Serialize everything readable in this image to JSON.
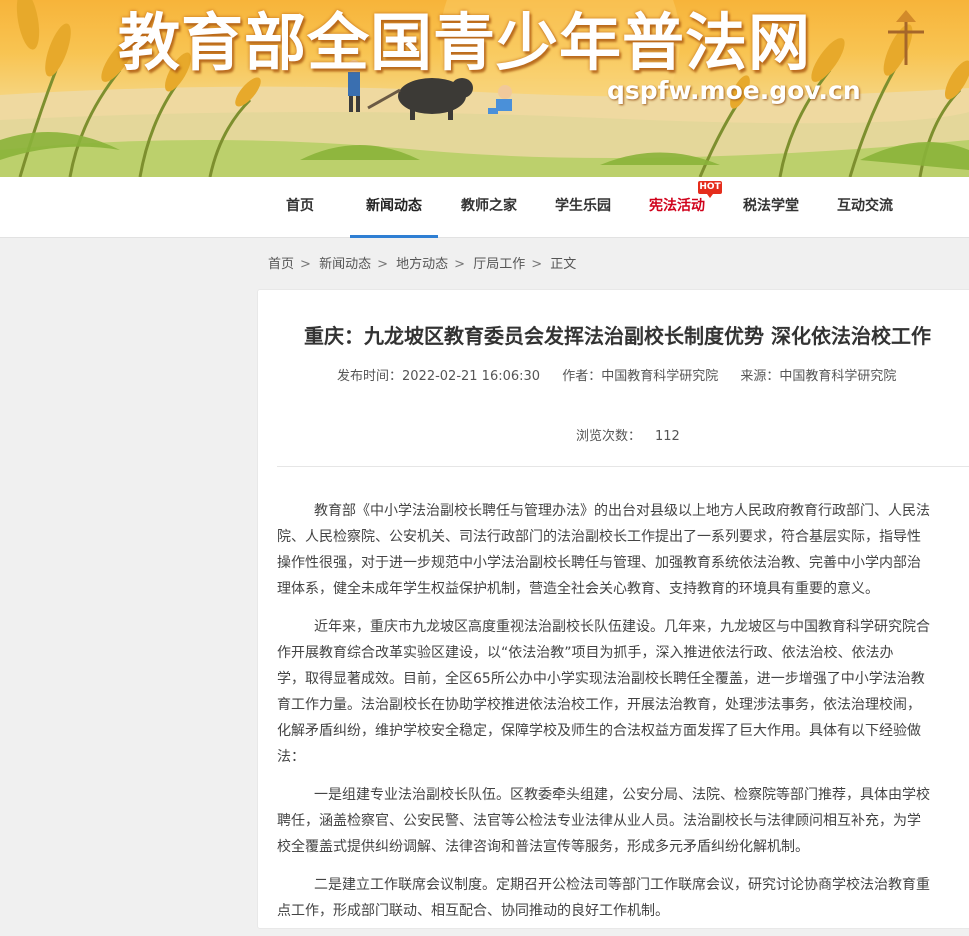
{
  "banner": {
    "title": "教育部全国青少年普法网",
    "url": "qspfw.moe.gov.cn"
  },
  "nav": {
    "items": [
      {
        "label": "首页"
      },
      {
        "label": "新闻动态",
        "active": true
      },
      {
        "label": "教师之家"
      },
      {
        "label": "学生乐园"
      },
      {
        "label": "宪法活动",
        "highlight": true
      },
      {
        "label": "税法学堂"
      },
      {
        "label": "互动交流"
      }
    ],
    "hot_badge": "HOT"
  },
  "breadcrumb": {
    "items": [
      "首页",
      "新闻动态",
      "地方动态",
      "厅局工作",
      "正文"
    ],
    "separator": ">"
  },
  "article": {
    "title": "重庆：九龙坡区教育委员会发挥法治副校长制度优势 深化依法治校工作",
    "publish_time": "发布时间：2022-02-21 16:06:30",
    "author": "作者：中国教育科学研究院",
    "source": "来源：中国教育科学研究院",
    "views_label": "浏览次数：",
    "views_count": "112",
    "paragraphs": [
      [
        "教育部《中小学法治副校长聘任与管理办法》的出台对县级以上地方人民政府教育行政部门、人民法",
        "院、人民检察院、公安机关、司法行政部门的法治副校长工作提出了一系列要求，符合基层实际，指导性",
        "操作性很强，对于进一步规范中小学法治副校长聘任与管理、加强教育系统依法治教、完善中小学内部治",
        "理体系，健全未成年学生权益保护机制，营造全社会关心教育、支持教育的环境具有重要的意义。"
      ],
      [
        "近年来，重庆市九龙坡区高度重视法治副校长队伍建设。几年来，九龙坡区与中国教育科学研究院合",
        "作开展教育综合改革实验区建设，以“依法治教”项目为抓手，深入推进依法行政、依法治校、依法办",
        "学，取得显著成效。目前，全区65所公办中小学实现法治副校长聘任全覆盖，进一步增强了中小学法治教",
        "育工作力量。法治副校长在协助学校推进依法治校工作，开展法治教育，处理涉法事务，依法治理校闹，",
        "化解矛盾纠纷，维护学校安全稳定，保障学校及师生的合法权益方面发挥了巨大作用。具体有以下经验做",
        "法："
      ],
      [
        "一是组建专业法治副校长队伍。区教委牵头组建，公安分局、法院、检察院等部门推荐，具体由学校",
        "聘任，涵盖检察官、公安民警、法官等公检法专业法律从业人员。法治副校长与法律顾问相互补充，为学",
        "校全覆盖式提供纠纷调解、法律咨询和普法宣传等服务，形成多元矛盾纠纷化解机制。"
      ],
      [
        "二是建立工作联席会议制度。定期召开公检法司等部门工作联席会议，研究讨论协商学校法治教育重",
        "点工作，形成部门联动、相互配合、协同推动的良好工作机制。"
      ]
    ]
  },
  "colors": {
    "nav_active_underline": "#2f7fd3",
    "highlight_red": "#d0021b",
    "hot_badge": "#e52d1c",
    "banner_sky": "#f7b43a"
  },
  "icons": [
    "farmer-with-ox-illustration",
    "scarecrow-illustration",
    "child-illustration",
    "wheat-field-illustration"
  ]
}
